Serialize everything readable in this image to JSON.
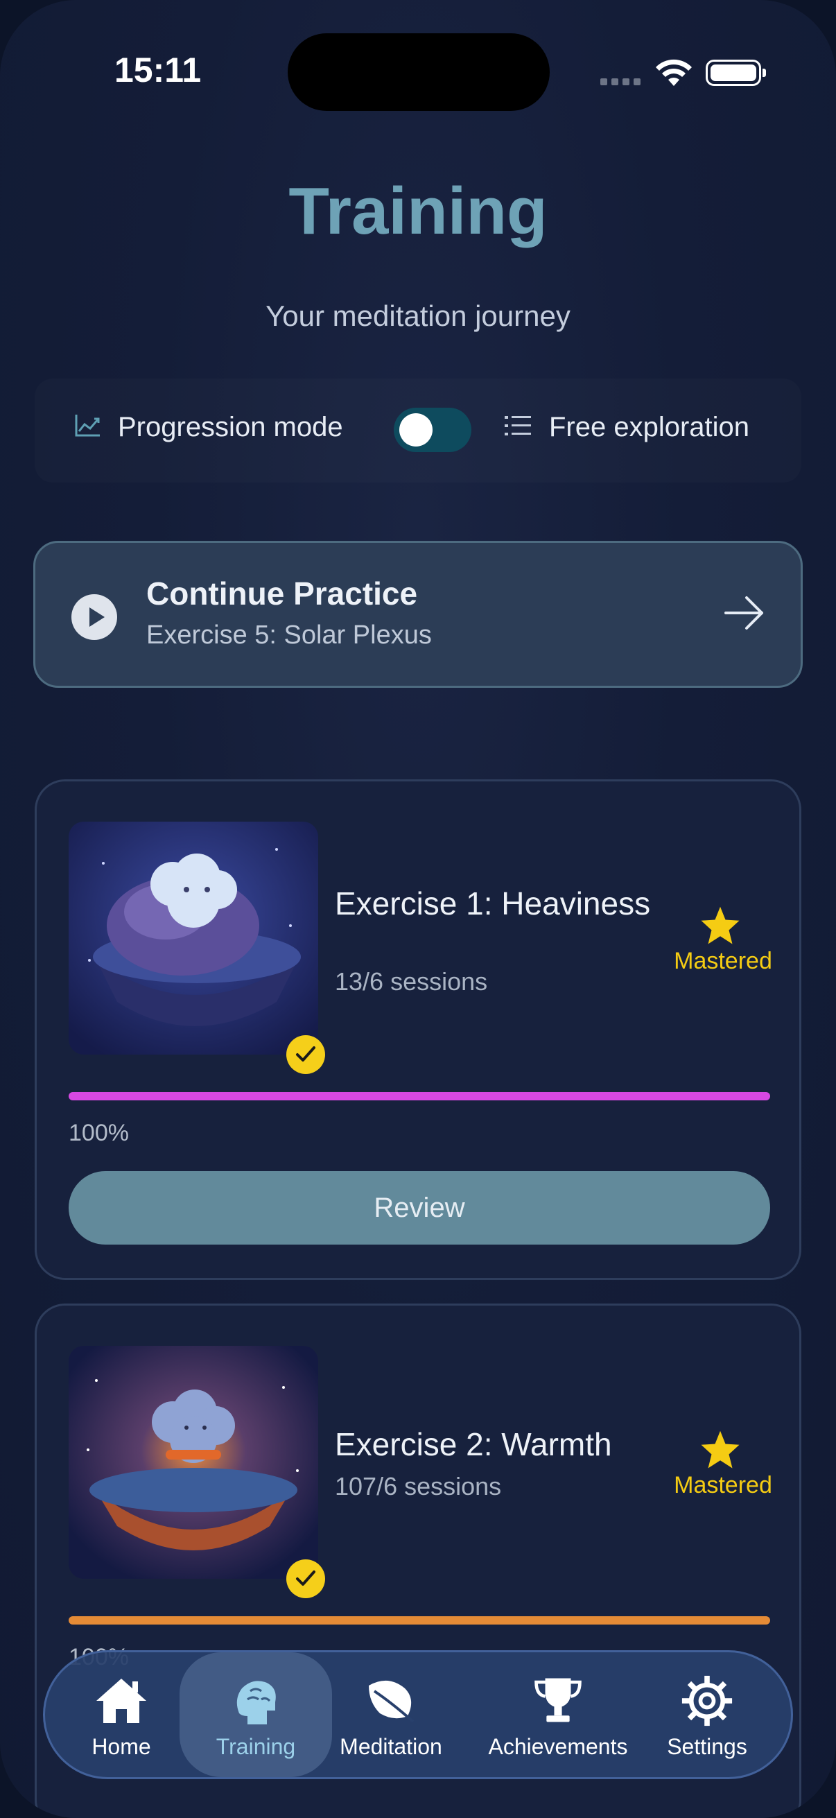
{
  "status": {
    "time": "15:11"
  },
  "header": {
    "title": "Training",
    "subtitle": "Your meditation journey"
  },
  "mode": {
    "left_label": "Progression mode",
    "right_label": "Free exploration",
    "toggle_on": false
  },
  "continue": {
    "title": "Continue Practice",
    "subtitle": "Exercise 5: Solar Plexus"
  },
  "exercises": [
    {
      "title": "Exercise 1: Heaviness",
      "sessions": "13/6 sessions",
      "badge": "Mastered",
      "progress": 1.0,
      "progress_label": "100%",
      "bar_color": "#d848e3",
      "action": "Review"
    },
    {
      "title": "Exercise 2: Warmth",
      "sessions": "107/6 sessions",
      "badge": "Mastered",
      "progress": 1.0,
      "progress_label": "100%",
      "bar_color": "#e58b36"
    }
  ],
  "tabs": [
    {
      "label": "Home",
      "icon": "home-icon"
    },
    {
      "label": "Training",
      "icon": "brain-icon",
      "active": true
    },
    {
      "label": "Meditation",
      "icon": "leaf-icon"
    },
    {
      "label": "Achievements",
      "icon": "trophy-icon"
    },
    {
      "label": "Settings",
      "icon": "gear-icon"
    }
  ],
  "colors": {
    "accent": "#6ea2b6",
    "mastered": "#f5cc13",
    "tab_active": "#9cd1ea"
  }
}
